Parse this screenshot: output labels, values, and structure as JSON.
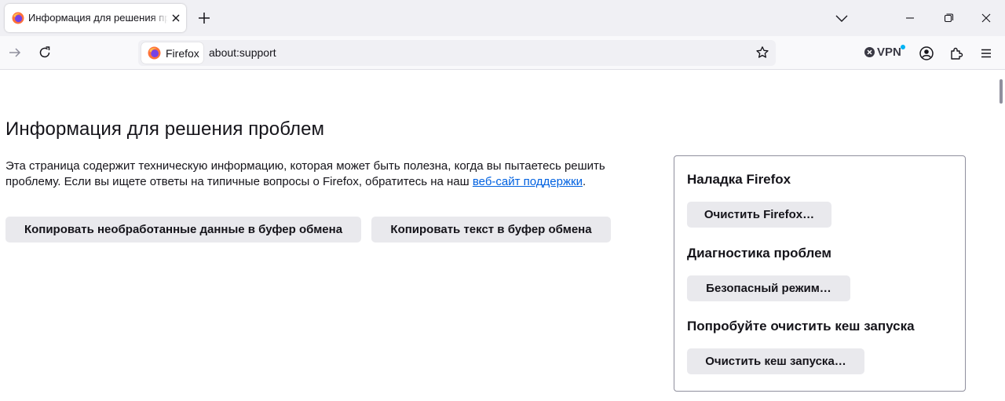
{
  "tab": {
    "title": "Информация для решения проблем",
    "favicon": "firefox-icon"
  },
  "window_controls": [
    "minimize-icon",
    "maximize-icon",
    "close-icon"
  ],
  "navbar": {
    "identity_label": "Firefox",
    "url": "about:support",
    "vpn_label": "VPN"
  },
  "page": {
    "title": "Информация для решения проблем",
    "description_text": "Эта страница содержит техническую информацию, которая может быть полезна, когда вы пытаетесь решить проблему. Если вы ищете ответы на типичные вопросы о Firefox, обратитесь на наш ",
    "description_link": "веб-сайт поддержки",
    "description_end": ".",
    "copy_raw_button": "Копировать необработанные данные в буфер обмена",
    "copy_text_button": "Копировать текст в буфер обмена"
  },
  "sidebox": {
    "refresh_heading": "Наладка Firefox",
    "refresh_button": "Очистить Firefox…",
    "diagnostics_heading": "Диагностика проблем",
    "safe_mode_button": "Безопасный режим…",
    "cache_heading": "Попробуйте очистить кеш запуска",
    "cache_button": "Очистить кеш запуска…"
  },
  "colors": {
    "accent_link": "#0061e0",
    "tabstrip_bg": "#f0f0f4",
    "button_bg": "#e9e9ed",
    "vpn_badge": "#00b3f4"
  }
}
